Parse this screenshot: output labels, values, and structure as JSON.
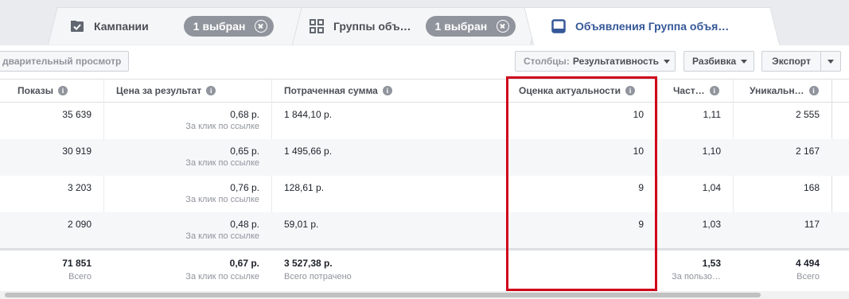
{
  "tabs": [
    {
      "label": "Кампании",
      "pill": "1 выбран",
      "icon": "checkbox-folder-icon"
    },
    {
      "label": "Группы объ…",
      "pill": "1 выбран",
      "icon": "grid-icon"
    },
    {
      "label": "Объявления Группа объя…",
      "icon": "ad-monitor-icon"
    }
  ],
  "toolbar": {
    "preview": "дварительный просмотр",
    "columns_label": "Столбцы:",
    "columns_value": "Результативность",
    "breakdown": "Разбивка",
    "export": "Экспорт"
  },
  "headers": [
    "Показы",
    "Цена за результат",
    "Потраченная сумма",
    "Оценка актуальности",
    "Част…",
    "Уникальн…"
  ],
  "rows": [
    {
      "impressions": "35 639",
      "cpr": "0,68 р.",
      "cpr_sub": "За клик по ссылке",
      "spent": "1 844,10 р.",
      "relevance": "10",
      "frequency": "1,11",
      "unique": "2 555"
    },
    {
      "impressions": "30 919",
      "cpr": "0,65 р.",
      "cpr_sub": "За клик по ссылке",
      "spent": "1 495,66 р.",
      "relevance": "10",
      "frequency": "1,10",
      "unique": "2 167"
    },
    {
      "impressions": "3 203",
      "cpr": "0,76 р.",
      "cpr_sub": "За клик по ссылке",
      "spent": "128,61 р.",
      "relevance": "9",
      "frequency": "1,04",
      "unique": "168"
    },
    {
      "impressions": "2 090",
      "cpr": "0,48 р.",
      "cpr_sub": "За клик по ссылке",
      "spent": "59,01 р.",
      "relevance": "9",
      "frequency": "1,03",
      "unique": "117"
    }
  ],
  "totals": {
    "impressions": "71 851",
    "impressions_sub": "Всего",
    "cpr": "0,67 р.",
    "cpr_sub": "За клик по ссылке",
    "spent": "3 527,38 р.",
    "spent_sub": "Всего потрачено",
    "frequency": "1,53",
    "frequency_sub": "За пользо…",
    "unique": "4 494",
    "unique_sub": "Всего"
  },
  "colors": {
    "highlight": "#d0021b",
    "link": "#365899",
    "pill": "#90949c"
  }
}
